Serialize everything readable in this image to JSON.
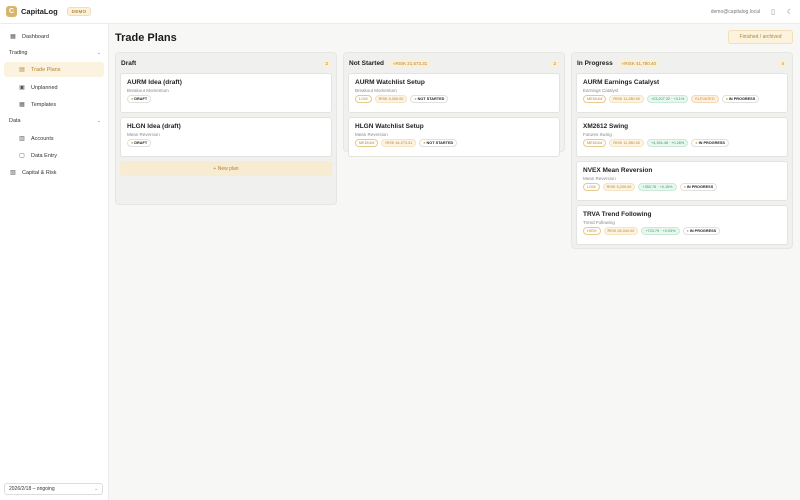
{
  "topbar": {
    "logo_letter": "C",
    "app_name": "CapitaLog",
    "badge": "DEMO",
    "user_email": "demo@capitalog.local"
  },
  "sidebar": {
    "dashboard": "Dashboard",
    "trading_section": "Trading",
    "trade_plans": "Trade Plans",
    "unplanned": "Unplanned",
    "templates": "Templates",
    "data_section": "Data",
    "accounts": "Accounts",
    "data_entry": "Data Entry",
    "capital_risk": "Capital & Risk",
    "period": "2026/2/18 – ongoing"
  },
  "main": {
    "title": "Trade Plans",
    "archived_button": "Finished / archived",
    "new_plan": "+ New plan"
  },
  "columns": [
    {
      "title": "Draft",
      "total": "",
      "count": "2",
      "cards": [
        {
          "title": "AURM Idea (draft)",
          "sub": "Breakout Momentum",
          "status": "DRAFT"
        },
        {
          "title": "HLGN Idea (draft)",
          "sub": "Mean Reversion",
          "status": "DRAFT"
        }
      ]
    },
    {
      "title": "Not Started",
      "total": "≈RISK 21,573.31",
      "count": "2",
      "cards": [
        {
          "title": "AURM Watchlist Setup",
          "sub": "Breakout Momentum",
          "risk": "LOW",
          "money": "RISK 5,300.00",
          "status": "NOT STARTED"
        },
        {
          "title": "HLGN Watchlist Setup",
          "sub": "Mean Reversion",
          "risk": "MEDIUM",
          "money": "RISK 16,273.31",
          "status": "NOT STARTED"
        }
      ]
    },
    {
      "title": "In Progress",
      "total": "≈RISK 41,780.40",
      "count": "4",
      "cards": [
        {
          "title": "AURM Earnings Catalyst",
          "sub": "Earnings Catalyst",
          "risk": "MEDIUM",
          "money": "RISK 11,280.00",
          "pnl": "+23,207.22 · +3.1%",
          "flag": "ELEVATED",
          "status": "IN PROGRESS"
        },
        {
          "title": "XM2612 Swing",
          "sub": "Futures Swing",
          "risk": "MEDIUM",
          "money": "RISK 11,280.00",
          "pnl": "+4,154.48 · +0.26%",
          "status": "IN PROGRESS"
        },
        {
          "title": "NVEX Mean Reversion",
          "sub": "Mean Reversion",
          "risk": "LOW",
          "money": "RISK 5,200.00",
          "pnl": "+353.76 · +0.15%",
          "status": "IN PROGRESS"
        },
        {
          "title": "TRVA Trend Following",
          "sub": "Trend Following",
          "risk": "HIGH",
          "money": "RISK 26,040.00",
          "pnl": "+723.79 · +0.03%",
          "status": "IN PROGRESS"
        }
      ]
    }
  ],
  "icons": {
    "sidebar_toggle": "▯",
    "theme": "☾",
    "dashboard": "▦",
    "trade_plans": "▤",
    "unplanned": "▣",
    "templates": "▦",
    "accounts": "▥",
    "data_entry": "▢",
    "capital_risk": "▧",
    "chevron": "⌄"
  },
  "colors": {
    "accent": "#b4852e",
    "accent_bg": "#fbf2df",
    "positive": "#2f9b66"
  }
}
